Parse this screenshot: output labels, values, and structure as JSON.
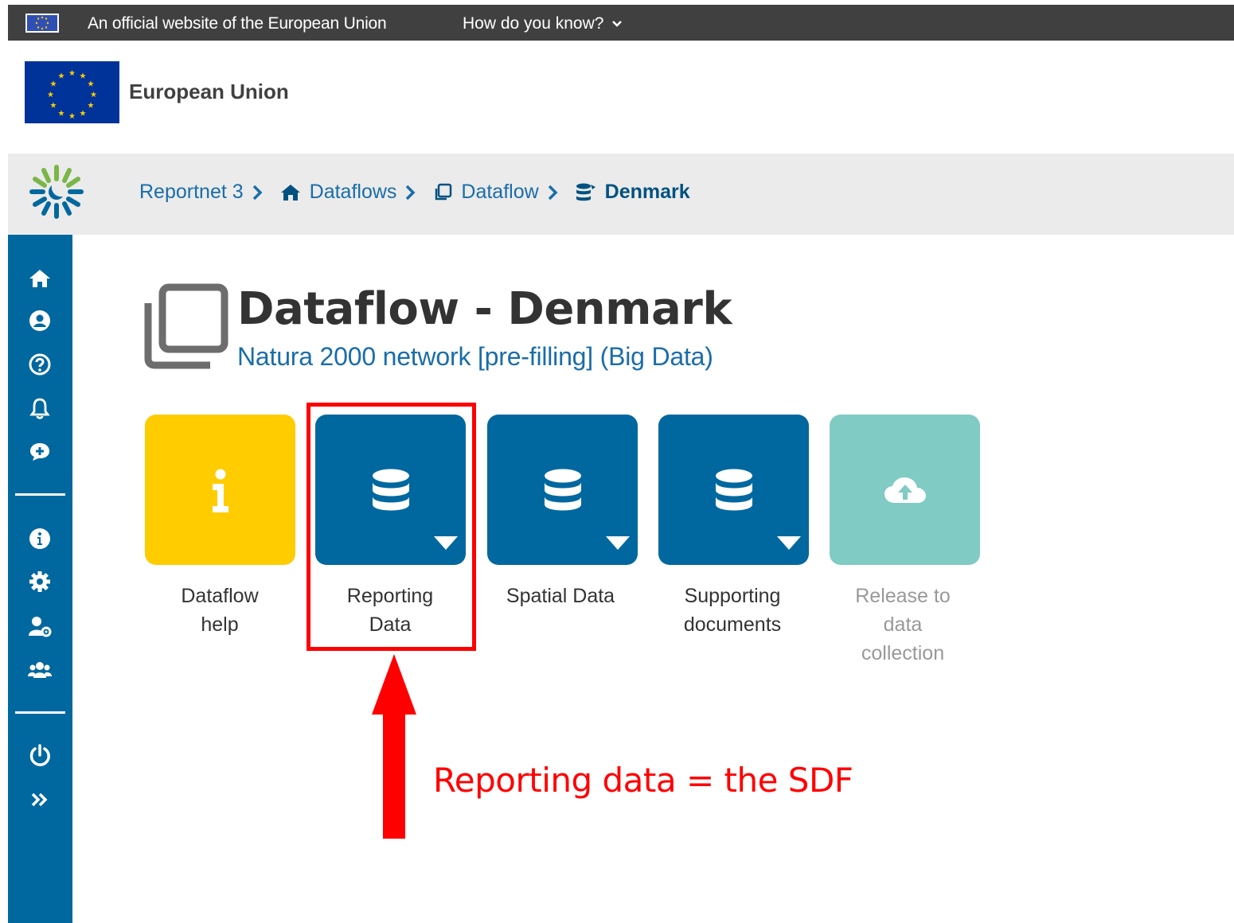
{
  "eu_banner": {
    "official_text": "An official website of the European Union",
    "how_do_you_know": "How do you know?"
  },
  "eu_header": {
    "title": "European Union"
  },
  "breadcrumb": [
    {
      "label": "Reportnet 3",
      "icon": "none"
    },
    {
      "label": "Dataflows",
      "icon": "home-icon"
    },
    {
      "label": "Dataflow",
      "icon": "clone-icon"
    },
    {
      "label": "Denmark",
      "icon": "database-icon"
    }
  ],
  "sidebar": {
    "icons": [
      "home-icon",
      "user-icon",
      "help-icon",
      "bell-icon",
      "feedback-icon",
      "info-icon",
      "settings-icon",
      "user-settings-icon",
      "users-icon",
      "power-icon",
      "expand-icon"
    ]
  },
  "page": {
    "title": "Dataflow - Denmark",
    "subtitle": "Natura 2000 network [pre-filling] (Big Data)"
  },
  "tiles": [
    {
      "label": "Dataflow help",
      "label_lines": [
        "Dataflow",
        "help"
      ],
      "color": "#ffcc00",
      "icon": "info-icon",
      "dropdown": false,
      "disabled": false
    },
    {
      "label": "Reporting Data",
      "label_lines": [
        "Reporting",
        "Data"
      ],
      "color": "#00689f",
      "icon": "database-icon",
      "dropdown": true,
      "disabled": false
    },
    {
      "label": "Spatial Data",
      "label_lines": [
        "Spatial Data"
      ],
      "color": "#00689f",
      "icon": "database-icon",
      "dropdown": true,
      "disabled": false
    },
    {
      "label": "Supporting documents",
      "label_lines": [
        "Supporting",
        "documents"
      ],
      "color": "#00689f",
      "icon": "database-icon",
      "dropdown": true,
      "disabled": false
    },
    {
      "label": "Release to data collection",
      "label_lines": [
        "Release to",
        "data",
        "collection"
      ],
      "color": "#80cbc4",
      "icon": "cloud-upload-icon",
      "dropdown": false,
      "disabled": true
    }
  ],
  "annotation": {
    "text": "Reporting data = the SDF",
    "color": "#ff0000"
  },
  "colors": {
    "primary": "#00689f",
    "link": "#1a6da8",
    "banner": "#404040"
  }
}
